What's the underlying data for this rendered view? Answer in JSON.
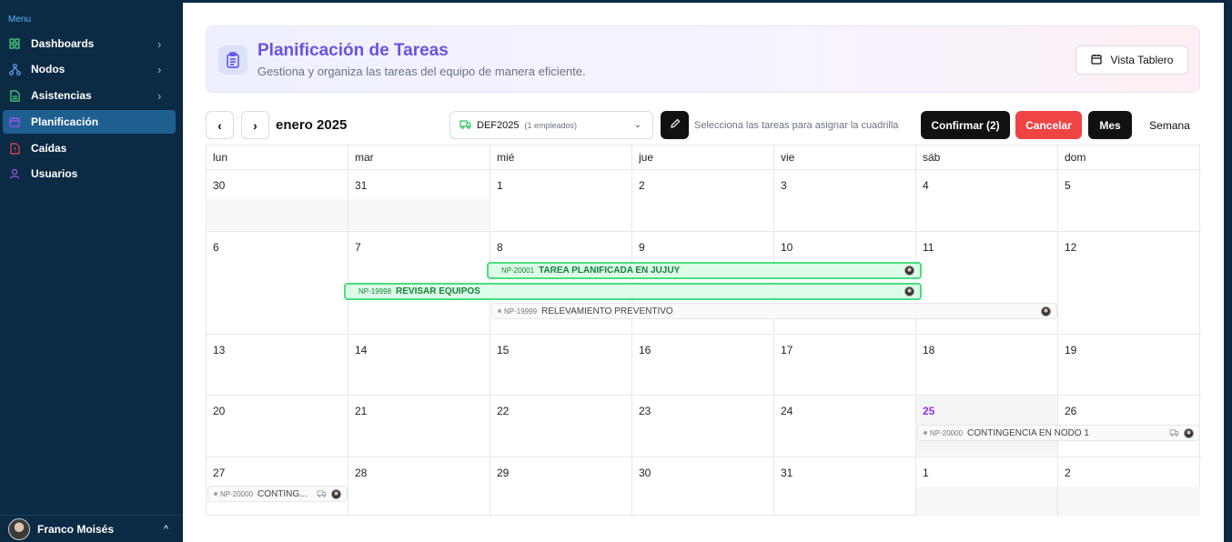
{
  "sidebar": {
    "menu_title": "Menu",
    "items": [
      {
        "label": "Dashboards",
        "icon": "grid-icon",
        "has_chevron": true,
        "color": "#4ade80"
      },
      {
        "label": "Nodos",
        "icon": "network-icon",
        "has_chevron": true,
        "color": "#60a5fa"
      },
      {
        "label": "Asistencias",
        "icon": "document-icon",
        "has_chevron": true,
        "color": "#4ade80"
      },
      {
        "label": "Planificación",
        "icon": "calendar-icon",
        "has_chevron": false,
        "active": true,
        "color": "#a855f7"
      },
      {
        "label": "Caídas",
        "icon": "file-alert-icon",
        "has_chevron": false,
        "color": "#ef4444"
      },
      {
        "label": "Usuarios",
        "icon": "user-icon",
        "has_chevron": false,
        "color": "#a855f7"
      }
    ],
    "user_name": "Franco Moisés"
  },
  "header": {
    "title": "Planificación de Tareas",
    "subtitle": "Gestiona y organiza las tareas del equipo de manera eficiente.",
    "board_button": "Vista Tablero"
  },
  "toolbar": {
    "prev": "‹",
    "next": "›",
    "month_label": "enero 2025",
    "crew_name": "DEF2025",
    "crew_count": "(1 empleados)",
    "hint": "Selecciona las tareas para asignar la cuadrilla",
    "confirm": "Confirmar (2)",
    "cancel": "Cancelar",
    "month_view": "Mes",
    "week_view": "Semana"
  },
  "calendar": {
    "weekdays": [
      "lun",
      "mar",
      "mié",
      "jue",
      "vie",
      "sáb",
      "dom"
    ],
    "weeks": [
      [
        "30",
        "31",
        "1",
        "2",
        "3",
        "4",
        "5"
      ],
      [
        "6",
        "7",
        "8",
        "9",
        "10",
        "11",
        "12"
      ],
      [
        "13",
        "14",
        "15",
        "16",
        "17",
        "18",
        "19"
      ],
      [
        "20",
        "21",
        "22",
        "23",
        "24",
        "25",
        "26"
      ],
      [
        "27",
        "28",
        "29",
        "30",
        "31",
        "1",
        "2"
      ]
    ],
    "today": "25"
  },
  "events": [
    {
      "code": "NP-20001",
      "title": "TAREA PLANIFICADA EN JUJUY",
      "selected": true
    },
    {
      "code": "NP-19998",
      "title": "REVISAR EQUIPOS",
      "selected": true
    },
    {
      "code": "NP-19999",
      "title": "RELEVAMIENTO PREVENTIVO",
      "selected": false
    },
    {
      "code": "NP-20000",
      "title": "CONTINGENCIA EN NODO 1",
      "selected": false,
      "has_crew": true
    },
    {
      "code": "NP-20000",
      "title": "CONTING...",
      "selected": false,
      "has_crew": true
    }
  ],
  "colors": {
    "sidebar_bg": "#0b2a44",
    "active_item": "#1d5f8f",
    "title_purple": "#6b52e0",
    "selected_green": "#4ade80",
    "cancel_red": "#ef4444",
    "today_purple": "#9333ea"
  }
}
